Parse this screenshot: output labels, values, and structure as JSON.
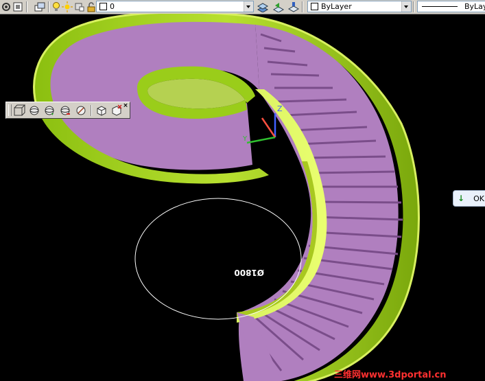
{
  "toolbar": {
    "layer_value": "0",
    "color_value": "ByLayer",
    "linetype_value": "ByLay"
  },
  "dimension": {
    "text": "Ø1800"
  },
  "prompt": {
    "button_label": "OK"
  },
  "watermark": {
    "text": "三维网www.3dportal.cn"
  },
  "colors": {
    "stair_tread": "#b07fbf",
    "stringer": "#9acd1a",
    "viewport_bg": "#000000",
    "watermark": "#ff3030"
  }
}
